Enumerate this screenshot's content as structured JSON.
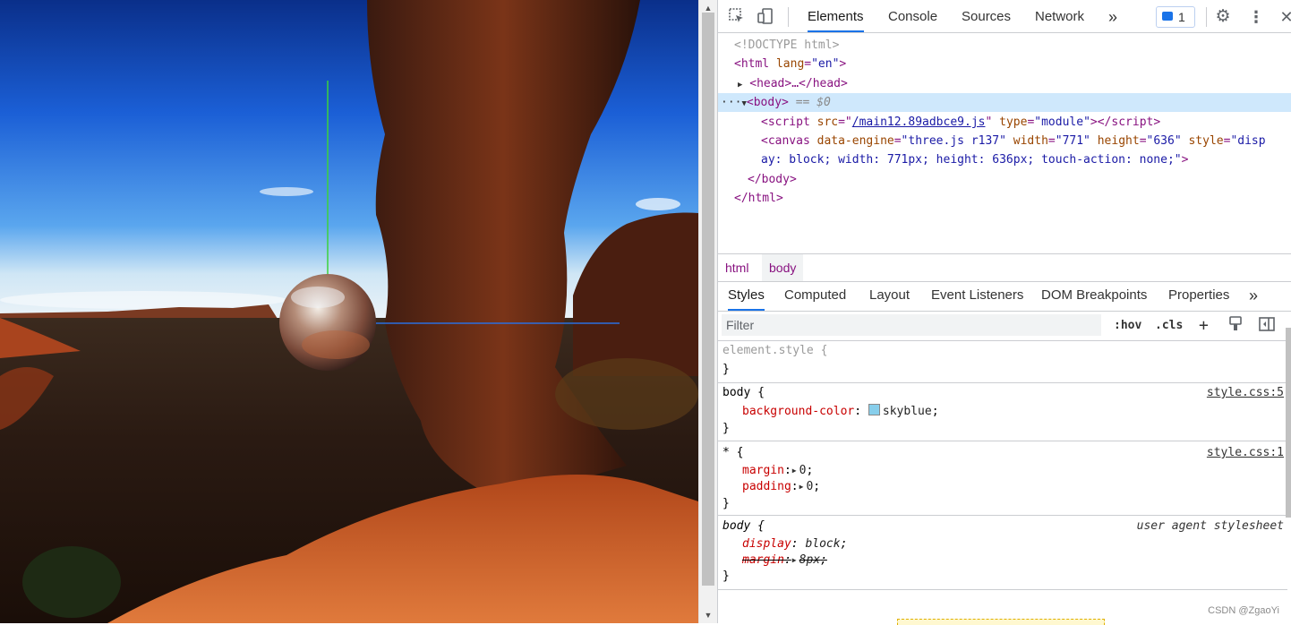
{
  "devtools": {
    "toolbar": {
      "tabs": [
        "Elements",
        "Console",
        "Sources",
        "Network"
      ],
      "active_tab": "Elements",
      "more": "»",
      "issues_count": "1",
      "icons": [
        "inspect-icon",
        "device-toggle-icon",
        "issues-icon",
        "gear-icon",
        "kebab-menu-icon",
        "close-icon"
      ]
    },
    "dom": {
      "doctype": "<!DOCTYPE html>",
      "html_open_tag": "<html",
      "html_lang_attr": "lang",
      "html_lang_val": "\"en\"",
      "html_close": ">",
      "head_collapsed": "<head>…</head>",
      "body_open": "<body>",
      "body_eq": "== $0",
      "script_src_attr": "src",
      "script_src_val": "/main12.89adbce9.js",
      "script_type_attr": "type",
      "script_type_val": "\"module\"",
      "canvas_line1_attrs": "data-engine",
      "canvas_engine_val": "\"three.js r137\"",
      "canvas_width_attr": "width",
      "canvas_width_val": "\"771\"",
      "canvas_height_attr": "height",
      "canvas_height_val": "\"636\"",
      "canvas_style_attr": "style",
      "canvas_style_val1": "\"disp",
      "canvas_style_val2": "ay: block; width: 771px; height: 636px; touch-action: none;\"",
      "body_close": "</body>",
      "html_close_tag": "</html>"
    },
    "breadcrumbs": [
      "html",
      "body"
    ],
    "subtabs": [
      "Styles",
      "Computed",
      "Layout",
      "Event Listeners",
      "DOM Breakpoints",
      "Properties"
    ],
    "subtabs_more": "»",
    "filter": {
      "placeholder": "Filter",
      "hov": ":hov",
      "cls": ".cls"
    },
    "rules": {
      "element_style": "element.style {",
      "r1_selector": "body {",
      "r1_source": "style.css:5",
      "r1_prop": "background-color",
      "r1_value": "skyblue",
      "r1_swatch": "#87ceeb",
      "r2_selector": "* {",
      "r2_source": "style.css:1",
      "r2_prop1": "margin",
      "r2_val1": "0",
      "r2_prop2": "padding",
      "r2_val2": "0",
      "r3_selector": "body {",
      "r3_source": "user agent stylesheet",
      "r3_prop1": "display",
      "r3_val1": "block",
      "r3_prop2": "margin",
      "r3_val2": "8px",
      "close": "}"
    }
  },
  "watermark": "CSDN @ZgaoYi",
  "colors": {
    "accent": "#1a73e8",
    "tag": "#881280",
    "attr": "#994500",
    "value": "#1a1aa6"
  }
}
